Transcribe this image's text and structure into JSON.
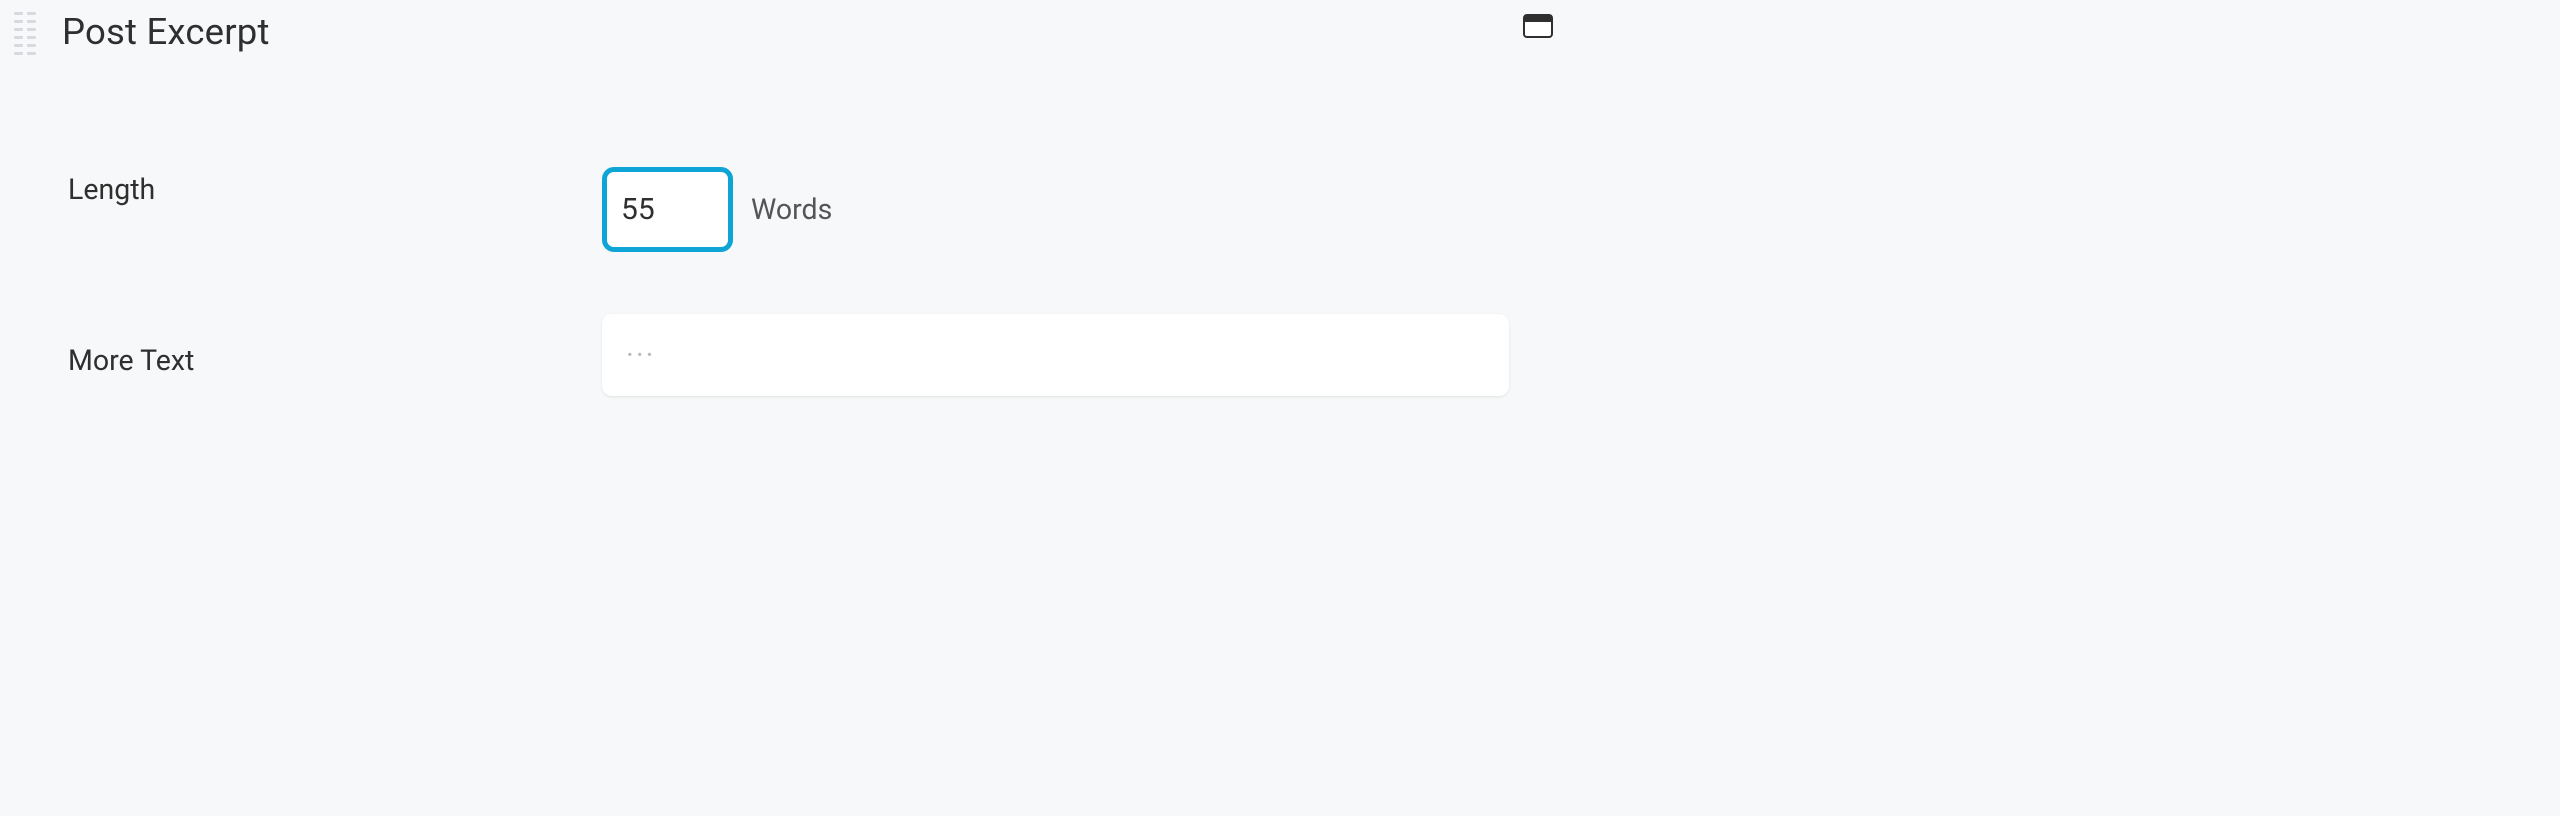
{
  "header": {
    "title": "Post Excerpt"
  },
  "fields": {
    "length": {
      "label": "Length",
      "value": "55",
      "unit": "Words"
    },
    "more_text": {
      "label": "More Text",
      "value": "",
      "placeholder": "···"
    }
  }
}
